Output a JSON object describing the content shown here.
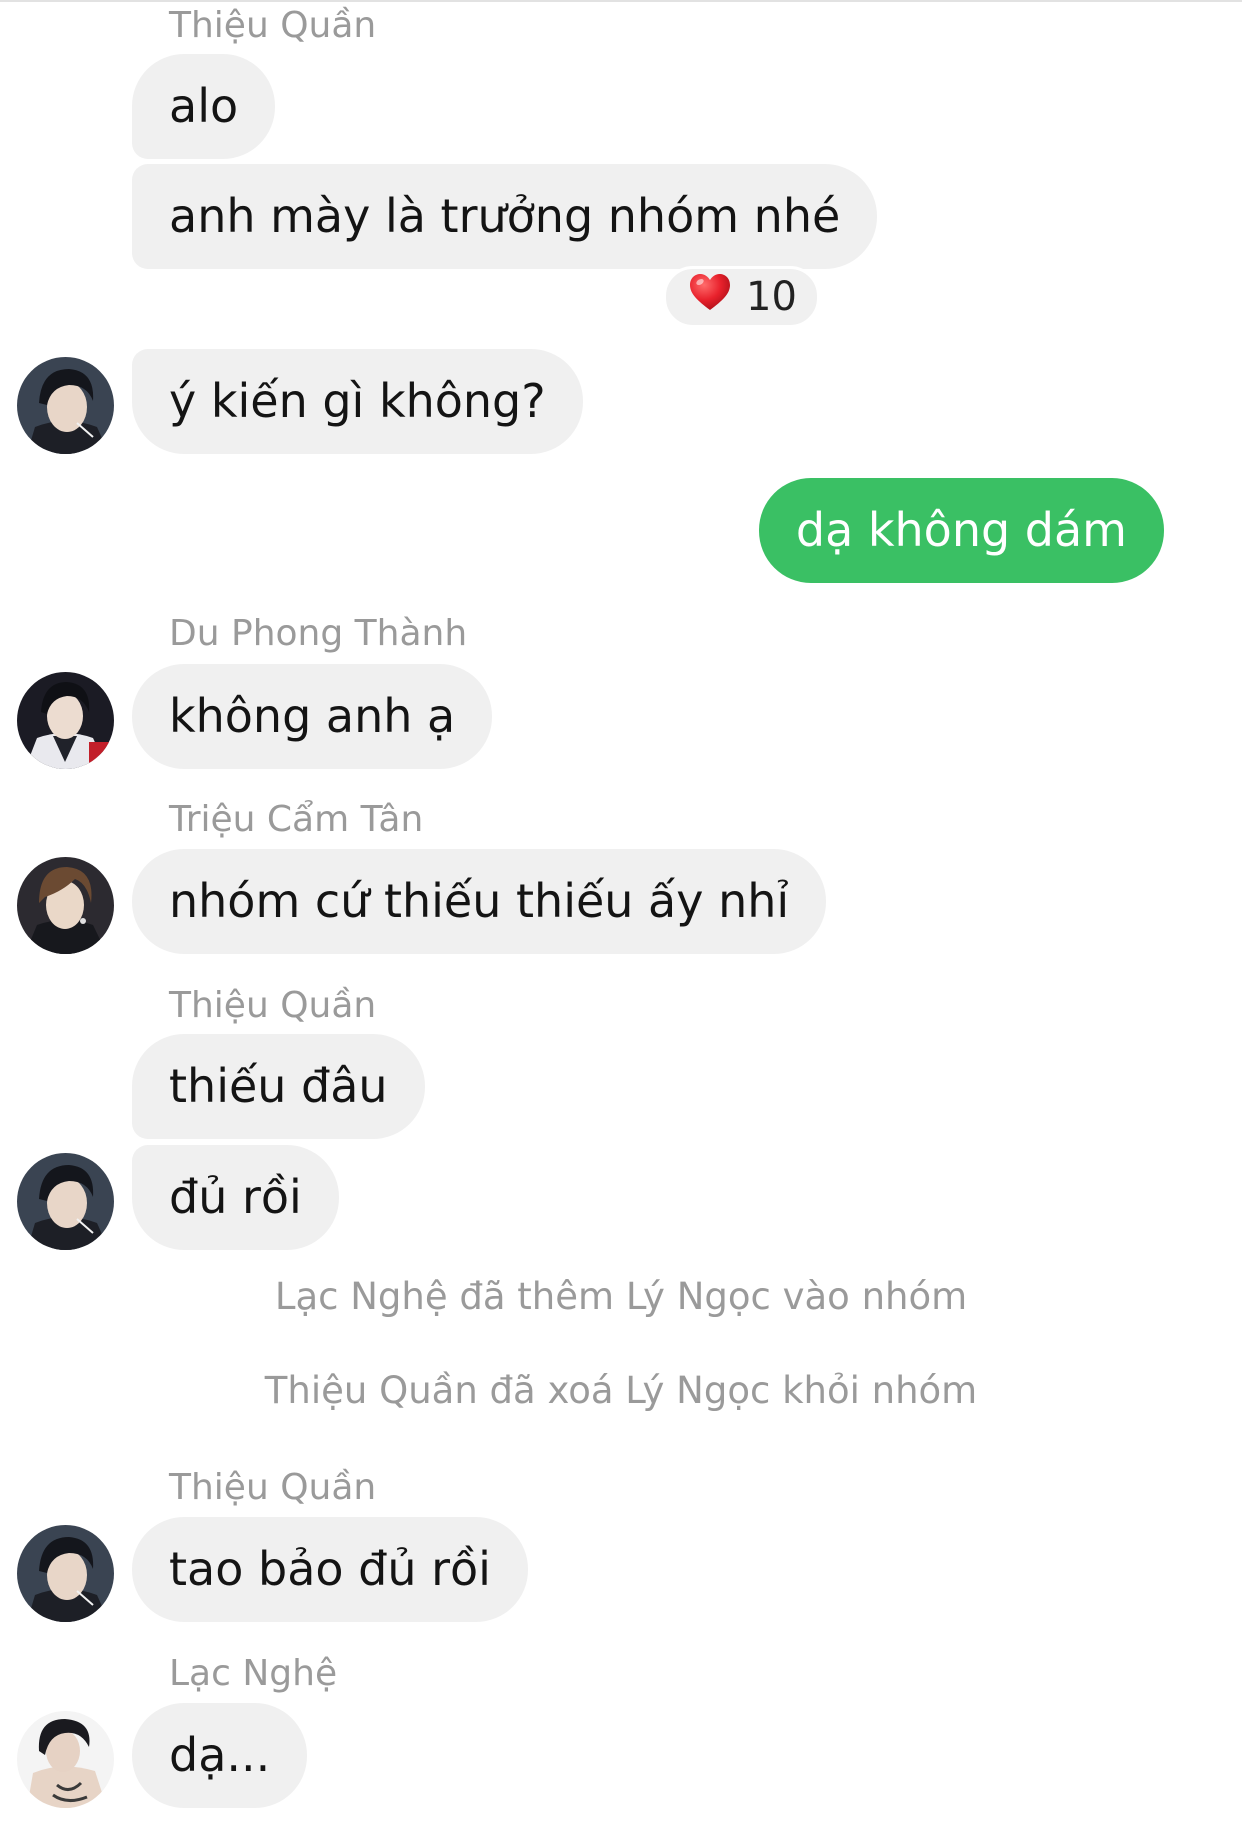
{
  "messages": {
    "m1": {
      "sender": "Thiệu Quần",
      "text": "alo"
    },
    "m2": {
      "text": "anh mày là trưởng nhóm nhé",
      "reaction_count": "10"
    },
    "m3": {
      "text": "ý kiến gì không?"
    },
    "m4": {
      "text": "dạ không dám"
    },
    "m5": {
      "sender": "Du Phong Thành",
      "text": "không anh ạ"
    },
    "m6": {
      "sender": "Triệu Cẩm Tân",
      "text": "nhóm cứ thiếu thiếu ấy nhỉ"
    },
    "m7": {
      "sender": "Thiệu Quần",
      "text": "thiếu đâu"
    },
    "m8": {
      "text": "đủ rồi"
    },
    "m9": {
      "sender": "Thiệu Quần",
      "text": "tao bảo đủ rồi"
    },
    "m10": {
      "sender": "Lạc Nghệ",
      "text": "dạ..."
    }
  },
  "system_messages": {
    "s1": "Lạc Nghệ đã thêm Lý Ngọc vào nhóm",
    "s2": "Thiệu Quần đã xoá Lý Ngọc khỏi nhóm"
  },
  "icons": {
    "reaction": "heart-icon",
    "avatars": [
      "avatar-thieu-quan",
      "avatar-du-phong-thanh",
      "avatar-trieu-cam-tan",
      "avatar-lac-nghe"
    ]
  },
  "colors": {
    "my_bubble": "#3ac064",
    "other_bubble": "#f0f0f0",
    "sender_name": "#9a9a9a",
    "heart": "#e8212c"
  }
}
